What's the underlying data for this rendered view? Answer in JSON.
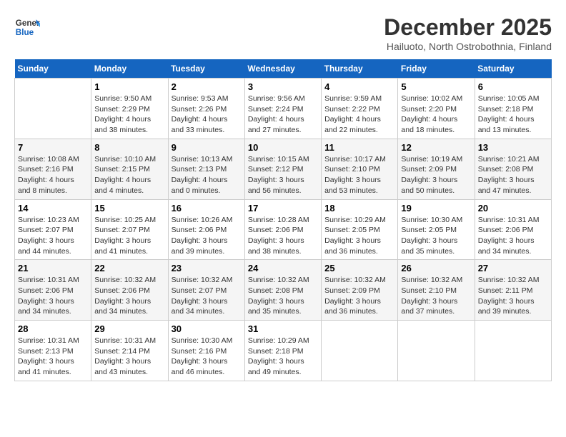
{
  "header": {
    "logo_line1": "General",
    "logo_line2": "Blue",
    "month_title": "December 2025",
    "subtitle": "Hailuoto, North Ostrobothnia, Finland"
  },
  "days_of_week": [
    "Sunday",
    "Monday",
    "Tuesday",
    "Wednesday",
    "Thursday",
    "Friday",
    "Saturday"
  ],
  "weeks": [
    [
      {
        "day": "",
        "info": ""
      },
      {
        "day": "1",
        "info": "Sunrise: 9:50 AM\nSunset: 2:29 PM\nDaylight: 4 hours\nand 38 minutes."
      },
      {
        "day": "2",
        "info": "Sunrise: 9:53 AM\nSunset: 2:26 PM\nDaylight: 4 hours\nand 33 minutes."
      },
      {
        "day": "3",
        "info": "Sunrise: 9:56 AM\nSunset: 2:24 PM\nDaylight: 4 hours\nand 27 minutes."
      },
      {
        "day": "4",
        "info": "Sunrise: 9:59 AM\nSunset: 2:22 PM\nDaylight: 4 hours\nand 22 minutes."
      },
      {
        "day": "5",
        "info": "Sunrise: 10:02 AM\nSunset: 2:20 PM\nDaylight: 4 hours\nand 18 minutes."
      },
      {
        "day": "6",
        "info": "Sunrise: 10:05 AM\nSunset: 2:18 PM\nDaylight: 4 hours\nand 13 minutes."
      }
    ],
    [
      {
        "day": "7",
        "info": "Sunrise: 10:08 AM\nSunset: 2:16 PM\nDaylight: 4 hours\nand 8 minutes."
      },
      {
        "day": "8",
        "info": "Sunrise: 10:10 AM\nSunset: 2:15 PM\nDaylight: 4 hours\nand 4 minutes."
      },
      {
        "day": "9",
        "info": "Sunrise: 10:13 AM\nSunset: 2:13 PM\nDaylight: 4 hours\nand 0 minutes."
      },
      {
        "day": "10",
        "info": "Sunrise: 10:15 AM\nSunset: 2:12 PM\nDaylight: 3 hours\nand 56 minutes."
      },
      {
        "day": "11",
        "info": "Sunrise: 10:17 AM\nSunset: 2:10 PM\nDaylight: 3 hours\nand 53 minutes."
      },
      {
        "day": "12",
        "info": "Sunrise: 10:19 AM\nSunset: 2:09 PM\nDaylight: 3 hours\nand 50 minutes."
      },
      {
        "day": "13",
        "info": "Sunrise: 10:21 AM\nSunset: 2:08 PM\nDaylight: 3 hours\nand 47 minutes."
      }
    ],
    [
      {
        "day": "14",
        "info": "Sunrise: 10:23 AM\nSunset: 2:07 PM\nDaylight: 3 hours\nand 44 minutes."
      },
      {
        "day": "15",
        "info": "Sunrise: 10:25 AM\nSunset: 2:07 PM\nDaylight: 3 hours\nand 41 minutes."
      },
      {
        "day": "16",
        "info": "Sunrise: 10:26 AM\nSunset: 2:06 PM\nDaylight: 3 hours\nand 39 minutes."
      },
      {
        "day": "17",
        "info": "Sunrise: 10:28 AM\nSunset: 2:06 PM\nDaylight: 3 hours\nand 38 minutes."
      },
      {
        "day": "18",
        "info": "Sunrise: 10:29 AM\nSunset: 2:05 PM\nDaylight: 3 hours\nand 36 minutes."
      },
      {
        "day": "19",
        "info": "Sunrise: 10:30 AM\nSunset: 2:05 PM\nDaylight: 3 hours\nand 35 minutes."
      },
      {
        "day": "20",
        "info": "Sunrise: 10:31 AM\nSunset: 2:06 PM\nDaylight: 3 hours\nand 34 minutes."
      }
    ],
    [
      {
        "day": "21",
        "info": "Sunrise: 10:31 AM\nSunset: 2:06 PM\nDaylight: 3 hours\nand 34 minutes."
      },
      {
        "day": "22",
        "info": "Sunrise: 10:32 AM\nSunset: 2:06 PM\nDaylight: 3 hours\nand 34 minutes."
      },
      {
        "day": "23",
        "info": "Sunrise: 10:32 AM\nSunset: 2:07 PM\nDaylight: 3 hours\nand 34 minutes."
      },
      {
        "day": "24",
        "info": "Sunrise: 10:32 AM\nSunset: 2:08 PM\nDaylight: 3 hours\nand 35 minutes."
      },
      {
        "day": "25",
        "info": "Sunrise: 10:32 AM\nSunset: 2:09 PM\nDaylight: 3 hours\nand 36 minutes."
      },
      {
        "day": "26",
        "info": "Sunrise: 10:32 AM\nSunset: 2:10 PM\nDaylight: 3 hours\nand 37 minutes."
      },
      {
        "day": "27",
        "info": "Sunrise: 10:32 AM\nSunset: 2:11 PM\nDaylight: 3 hours\nand 39 minutes."
      }
    ],
    [
      {
        "day": "28",
        "info": "Sunrise: 10:31 AM\nSunset: 2:13 PM\nDaylight: 3 hours\nand 41 minutes."
      },
      {
        "day": "29",
        "info": "Sunrise: 10:31 AM\nSunset: 2:14 PM\nDaylight: 3 hours\nand 43 minutes."
      },
      {
        "day": "30",
        "info": "Sunrise: 10:30 AM\nSunset: 2:16 PM\nDaylight: 3 hours\nand 46 minutes."
      },
      {
        "day": "31",
        "info": "Sunrise: 10:29 AM\nSunset: 2:18 PM\nDaylight: 3 hours\nand 49 minutes."
      },
      {
        "day": "",
        "info": ""
      },
      {
        "day": "",
        "info": ""
      },
      {
        "day": "",
        "info": ""
      }
    ]
  ]
}
